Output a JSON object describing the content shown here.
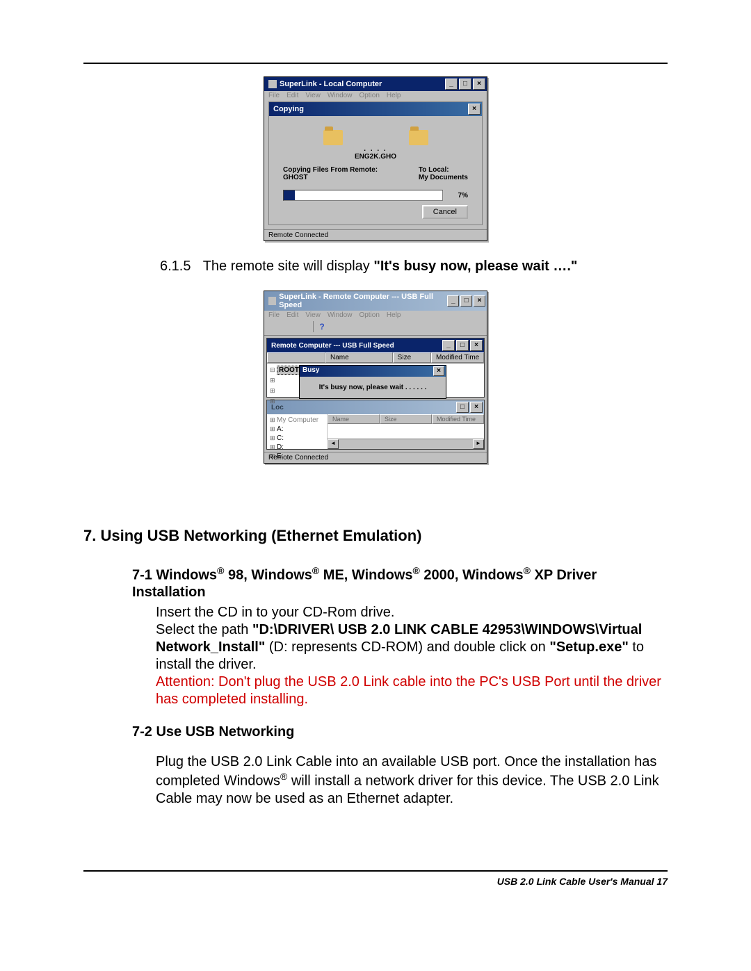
{
  "fig1": {
    "window_title": "SuperLink - Local Computer",
    "menus": [
      "File",
      "Edit",
      "View",
      "Window",
      "Option",
      "Help"
    ],
    "dlg_title": "Copying",
    "filename": "ENG2K.GHO",
    "from_label": "Copying Files From Remote:",
    "from_val": "GHOST",
    "to_label": "To Local:",
    "to_val": "My Documents",
    "pct": "7%",
    "cancel": "Cancel",
    "status": "Remote Connected"
  },
  "para615": {
    "num": "6.1.5",
    "prefix": "The remote site will display ",
    "quote": "\"It's busy now, please wait ….\""
  },
  "fig2": {
    "window_title": "SuperLink - Remote Computer --- USB Full Speed",
    "menus": [
      "File",
      "Edit",
      "View",
      "Window",
      "Option",
      "Help"
    ],
    "pane_title": "Remote Computer --- USB Full Speed",
    "col_name": "Name",
    "col_size": "Size",
    "col_mtime": "Modified Time",
    "root": "ROOT",
    "busy_title": "Busy",
    "busy_msg": "It's busy now, please wait . . . . . .",
    "drives": [
      "A:",
      "C:",
      "D:",
      "E:"
    ],
    "detail_cols": [
      "Name",
      "Size",
      "Modified Time"
    ],
    "status": "Remote Connected"
  },
  "sec7": {
    "heading": "7.  Using USB Networking (Ethernet Emulation)",
    "s71_num": "7-1 ",
    "s71_title_a": "Windows",
    "s71_title_b": " 98, Windows",
    "s71_title_c": " ME, Windows",
    "s71_title_d": " 2000, Windows",
    "s71_title_e": " XP Driver Installation",
    "line1": "Insert the CD in to your CD-Rom drive.",
    "line2a": "Select the path ",
    "line2b": "\"D:\\DRIVER\\ USB 2.0 LINK CABLE 42953\\WINDOWS\\Virtual Network_Install\"",
    "line2c": " (D: represents CD-ROM) and double click on ",
    "line2d": "\"Setup.exe\"",
    "line2e": " to install the driver.",
    "warn": "Attention: Don't plug the USB 2.0 Link cable into the PC's USB Port until the driver has completed installing.",
    "s72": "7-2 Use USB Networking",
    "p72a": "Plug the USB 2.0 Link Cable into an available USB port. Once the installation has completed Windows",
    "p72b": " will install a network driver for this device.  The USB 2.0 Link Cable may now be used as an Ethernet adapter."
  },
  "footer": "USB 2.0 Link Cable User's Manual 17"
}
